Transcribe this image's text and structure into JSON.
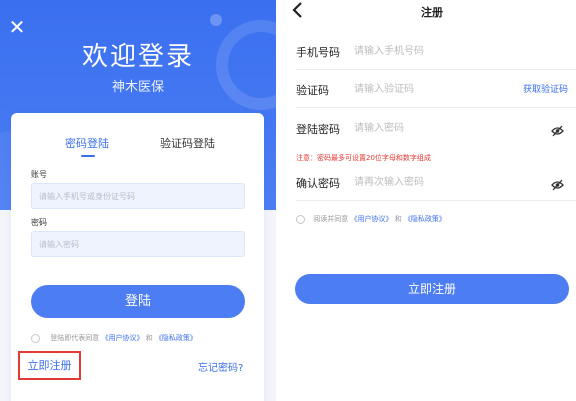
{
  "colors": {
    "primary": "#3a6ff0",
    "button": "#4d7df3",
    "warning": "#e53935",
    "highlight_border": "#e53935"
  },
  "login": {
    "close_icon": "close-icon",
    "title": "欢迎登录",
    "subtitle": "神木医保",
    "tabs": [
      {
        "label": "密码登陆",
        "active": true
      },
      {
        "label": "验证码登陆",
        "active": false
      }
    ],
    "account_label": "账号",
    "account_placeholder": "请输入手机号或身份证号码",
    "password_label": "密码",
    "password_placeholder": "请输入密码",
    "login_button": "登陆",
    "agree_prefix": "登陆即代表同意",
    "agree_user_agreement": "《用户协议》",
    "agree_and": "和",
    "agree_privacy": "《隐私政策》",
    "register_link": "立即注册",
    "forgot_link": "忘记密码?"
  },
  "register": {
    "back_icon": "chevron-left-icon",
    "title": "注册",
    "phone_label": "手机号码",
    "phone_placeholder": "请输入手机号码",
    "code_label": "验证码",
    "code_placeholder": "请输入验证码",
    "get_code": "获取验证码",
    "password_label": "登陆密码",
    "password_placeholder": "请输入密码",
    "password_hint": "注意：密码最多可设置20位字母和数字组成",
    "confirm_label": "确认密码",
    "confirm_placeholder": "请再次输入密码",
    "eye_icon": "eye-off-icon",
    "agree_prefix": "阅读并同意",
    "agree_user_agreement": "《用户协议》",
    "agree_and": "和",
    "agree_privacy": "《隐私政策》",
    "register_button": "立即注册"
  }
}
